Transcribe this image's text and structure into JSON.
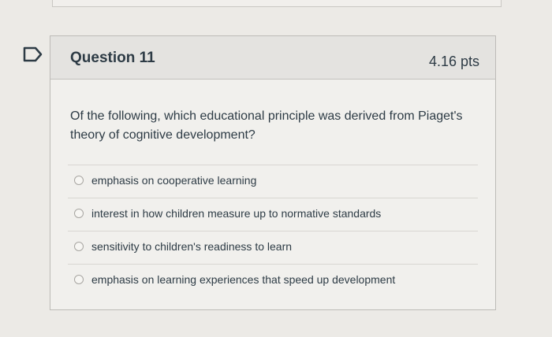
{
  "question": {
    "title": "Question 11",
    "points": "4.16 pts",
    "text": "Of the following, which educational principle was derived from Piaget's theory of cognitive development?",
    "answers": [
      {
        "label": "emphasis on cooperative learning"
      },
      {
        "label": "interest in how children measure up to normative standards"
      },
      {
        "label": "sensitivity to children's readiness to learn"
      },
      {
        "label": "emphasis on learning experiences that speed up development"
      }
    ]
  },
  "colors": {
    "text": "#2d3b45",
    "header_bg": "#e4e3e0",
    "card_bg": "#f1f0ed"
  },
  "icons": {
    "flag": "flag-question-icon"
  }
}
